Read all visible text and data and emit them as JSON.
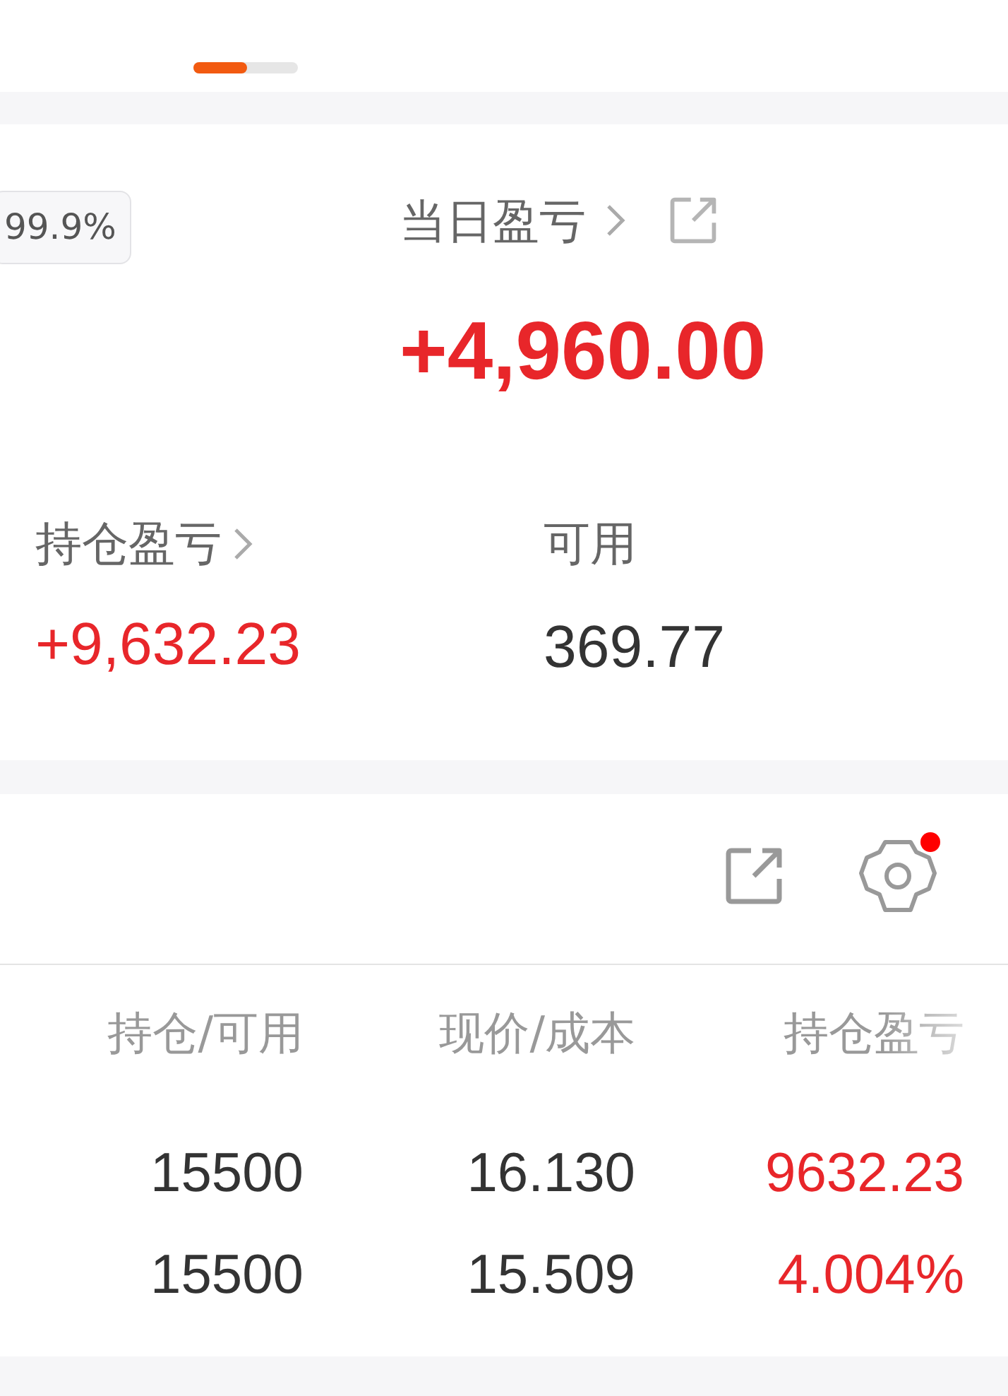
{
  "pager": {
    "level": 0.51
  },
  "summary": {
    "badge": "99.9%",
    "daily_pnl": {
      "label": "当日盈亏",
      "value": "+4,960.00"
    },
    "holding_pnl": {
      "label": "持仓盈亏",
      "value": "+9,632.23"
    },
    "available": {
      "label": "可用",
      "value": "369.77"
    }
  },
  "positions": {
    "settings_dot": true,
    "columns": [
      "持仓/可用",
      "现价/成本",
      "持仓盈亏"
    ],
    "rows": [
      [
        "15500",
        "16.130",
        "9632.23"
      ],
      [
        "15500",
        "15.509",
        "4.004%"
      ]
    ]
  }
}
